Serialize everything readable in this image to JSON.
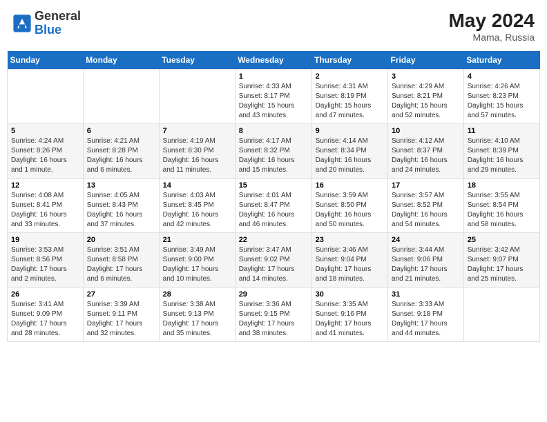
{
  "header": {
    "logo_text_general": "General",
    "logo_text_blue": "Blue",
    "main_title": "May 2024",
    "sub_title": "Mama, Russia"
  },
  "weekdays": [
    "Sunday",
    "Monday",
    "Tuesday",
    "Wednesday",
    "Thursday",
    "Friday",
    "Saturday"
  ],
  "weeks": [
    [
      {
        "day": "",
        "info": ""
      },
      {
        "day": "",
        "info": ""
      },
      {
        "day": "",
        "info": ""
      },
      {
        "day": "1",
        "info": "Sunrise: 4:33 AM\nSunset: 8:17 PM\nDaylight: 15 hours and 43 minutes."
      },
      {
        "day": "2",
        "info": "Sunrise: 4:31 AM\nSunset: 8:19 PM\nDaylight: 15 hours and 47 minutes."
      },
      {
        "day": "3",
        "info": "Sunrise: 4:29 AM\nSunset: 8:21 PM\nDaylight: 15 hours and 52 minutes."
      },
      {
        "day": "4",
        "info": "Sunrise: 4:26 AM\nSunset: 8:23 PM\nDaylight: 15 hours and 57 minutes."
      }
    ],
    [
      {
        "day": "5",
        "info": "Sunrise: 4:24 AM\nSunset: 8:26 PM\nDaylight: 16 hours and 1 minute."
      },
      {
        "day": "6",
        "info": "Sunrise: 4:21 AM\nSunset: 8:28 PM\nDaylight: 16 hours and 6 minutes."
      },
      {
        "day": "7",
        "info": "Sunrise: 4:19 AM\nSunset: 8:30 PM\nDaylight: 16 hours and 11 minutes."
      },
      {
        "day": "8",
        "info": "Sunrise: 4:17 AM\nSunset: 8:32 PM\nDaylight: 16 hours and 15 minutes."
      },
      {
        "day": "9",
        "info": "Sunrise: 4:14 AM\nSunset: 8:34 PM\nDaylight: 16 hours and 20 minutes."
      },
      {
        "day": "10",
        "info": "Sunrise: 4:12 AM\nSunset: 8:37 PM\nDaylight: 16 hours and 24 minutes."
      },
      {
        "day": "11",
        "info": "Sunrise: 4:10 AM\nSunset: 8:39 PM\nDaylight: 16 hours and 29 minutes."
      }
    ],
    [
      {
        "day": "12",
        "info": "Sunrise: 4:08 AM\nSunset: 8:41 PM\nDaylight: 16 hours and 33 minutes."
      },
      {
        "day": "13",
        "info": "Sunrise: 4:05 AM\nSunset: 8:43 PM\nDaylight: 16 hours and 37 minutes."
      },
      {
        "day": "14",
        "info": "Sunrise: 4:03 AM\nSunset: 8:45 PM\nDaylight: 16 hours and 42 minutes."
      },
      {
        "day": "15",
        "info": "Sunrise: 4:01 AM\nSunset: 8:47 PM\nDaylight: 16 hours and 46 minutes."
      },
      {
        "day": "16",
        "info": "Sunrise: 3:59 AM\nSunset: 8:50 PM\nDaylight: 16 hours and 50 minutes."
      },
      {
        "day": "17",
        "info": "Sunrise: 3:57 AM\nSunset: 8:52 PM\nDaylight: 16 hours and 54 minutes."
      },
      {
        "day": "18",
        "info": "Sunrise: 3:55 AM\nSunset: 8:54 PM\nDaylight: 16 hours and 58 minutes."
      }
    ],
    [
      {
        "day": "19",
        "info": "Sunrise: 3:53 AM\nSunset: 8:56 PM\nDaylight: 17 hours and 2 minutes."
      },
      {
        "day": "20",
        "info": "Sunrise: 3:51 AM\nSunset: 8:58 PM\nDaylight: 17 hours and 6 minutes."
      },
      {
        "day": "21",
        "info": "Sunrise: 3:49 AM\nSunset: 9:00 PM\nDaylight: 17 hours and 10 minutes."
      },
      {
        "day": "22",
        "info": "Sunrise: 3:47 AM\nSunset: 9:02 PM\nDaylight: 17 hours and 14 minutes."
      },
      {
        "day": "23",
        "info": "Sunrise: 3:46 AM\nSunset: 9:04 PM\nDaylight: 17 hours and 18 minutes."
      },
      {
        "day": "24",
        "info": "Sunrise: 3:44 AM\nSunset: 9:06 PM\nDaylight: 17 hours and 21 minutes."
      },
      {
        "day": "25",
        "info": "Sunrise: 3:42 AM\nSunset: 9:07 PM\nDaylight: 17 hours and 25 minutes."
      }
    ],
    [
      {
        "day": "26",
        "info": "Sunrise: 3:41 AM\nSunset: 9:09 PM\nDaylight: 17 hours and 28 minutes."
      },
      {
        "day": "27",
        "info": "Sunrise: 3:39 AM\nSunset: 9:11 PM\nDaylight: 17 hours and 32 minutes."
      },
      {
        "day": "28",
        "info": "Sunrise: 3:38 AM\nSunset: 9:13 PM\nDaylight: 17 hours and 35 minutes."
      },
      {
        "day": "29",
        "info": "Sunrise: 3:36 AM\nSunset: 9:15 PM\nDaylight: 17 hours and 38 minutes."
      },
      {
        "day": "30",
        "info": "Sunrise: 3:35 AM\nSunset: 9:16 PM\nDaylight: 17 hours and 41 minutes."
      },
      {
        "day": "31",
        "info": "Sunrise: 3:33 AM\nSunset: 9:18 PM\nDaylight: 17 hours and 44 minutes."
      },
      {
        "day": "",
        "info": ""
      }
    ]
  ]
}
